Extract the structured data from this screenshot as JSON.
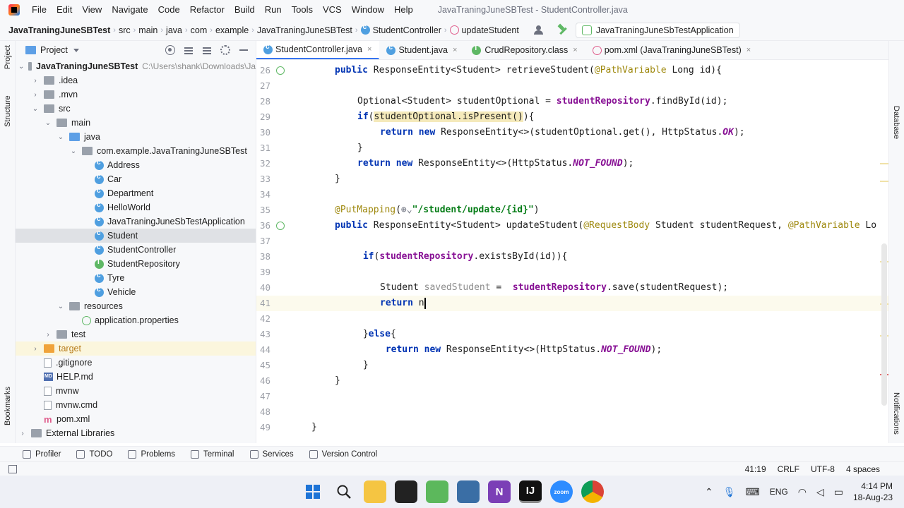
{
  "window": {
    "title": "JavaTraningJuneSBTest - StudentController.java",
    "menu": [
      "File",
      "Edit",
      "View",
      "Navigate",
      "Code",
      "Refactor",
      "Build",
      "Run",
      "Tools",
      "VCS",
      "Window",
      "Help"
    ]
  },
  "breadcrumb": [
    "JavaTraningJuneSBTest",
    "src",
    "main",
    "java",
    "com",
    "example",
    "JavaTraningJuneSBTest",
    "StudentController",
    "updateStudent"
  ],
  "run_config": "JavaTraningJuneSbTestApplication",
  "left_strip": [
    "Project",
    "Structure",
    "Bookmarks"
  ],
  "right_strip": [
    "Database",
    "Notifications"
  ],
  "project_panel": {
    "title": "Project",
    "root_name": "JavaTraningJuneSBTest",
    "root_path": "C:\\Users\\shank\\Downloads\\Ja",
    "items": [
      {
        "label": ".idea",
        "depth": 1,
        "chev": "›",
        "icon": "folder"
      },
      {
        "label": ".mvn",
        "depth": 1,
        "chev": "›",
        "icon": "folder"
      },
      {
        "label": "src",
        "depth": 1,
        "chev": "⌄",
        "icon": "folder"
      },
      {
        "label": "main",
        "depth": 2,
        "chev": "⌄",
        "icon": "folder"
      },
      {
        "label": "java",
        "depth": 3,
        "chev": "⌄",
        "icon": "folder-blue"
      },
      {
        "label": "com.example.JavaTraningJuneSBTest",
        "depth": 4,
        "chev": "⌄",
        "icon": "folder"
      },
      {
        "label": "Address",
        "depth": 5,
        "chev": "",
        "icon": "class"
      },
      {
        "label": "Car",
        "depth": 5,
        "chev": "",
        "icon": "class"
      },
      {
        "label": "Department",
        "depth": 5,
        "chev": "",
        "icon": "class"
      },
      {
        "label": "HelloWorld",
        "depth": 5,
        "chev": "",
        "icon": "class"
      },
      {
        "label": "JavaTraningJuneSbTestApplication",
        "depth": 5,
        "chev": "",
        "icon": "class"
      },
      {
        "label": "Student",
        "depth": 5,
        "chev": "",
        "icon": "class",
        "selected": true
      },
      {
        "label": "StudentController",
        "depth": 5,
        "chev": "",
        "icon": "class"
      },
      {
        "label": "StudentRepository",
        "depth": 5,
        "chev": "",
        "icon": "interface"
      },
      {
        "label": "Tyre",
        "depth": 5,
        "chev": "",
        "icon": "class"
      },
      {
        "label": "Vehicle",
        "depth": 5,
        "chev": "",
        "icon": "class"
      },
      {
        "label": "resources",
        "depth": 3,
        "chev": "⌄",
        "icon": "folder"
      },
      {
        "label": "application.properties",
        "depth": 4,
        "chev": "",
        "icon": "properties"
      },
      {
        "label": "test",
        "depth": 2,
        "chev": "›",
        "icon": "folder"
      },
      {
        "label": "target",
        "depth": 1,
        "chev": "›",
        "icon": "folder-orange",
        "target": true
      },
      {
        "label": ".gitignore",
        "depth": 1,
        "chev": "",
        "icon": "doc"
      },
      {
        "label": "HELP.md",
        "depth": 1,
        "chev": "",
        "icon": "md"
      },
      {
        "label": "mvnw",
        "depth": 1,
        "chev": "",
        "icon": "doc"
      },
      {
        "label": "mvnw.cmd",
        "depth": 1,
        "chev": "",
        "icon": "doc"
      },
      {
        "label": "pom.xml",
        "depth": 1,
        "chev": "",
        "icon": "maven"
      },
      {
        "label": "External Libraries",
        "depth": 0,
        "chev": "›",
        "icon": "lib"
      }
    ]
  },
  "tabs": [
    {
      "label": "StudentController.java",
      "icon": "class",
      "active": true
    },
    {
      "label": "Student.java",
      "icon": "class"
    },
    {
      "label": "CrudRepository.class",
      "icon": "interface"
    },
    {
      "label": "pom.xml (JavaTraningJuneSBTest)",
      "icon": "maven"
    }
  ],
  "code_lines": [
    {
      "n": "26",
      "html": "<span class=\"kw\">public</span> ResponseEntity&lt;Student&gt; retrieveStudent(<span class=\"ann\">@PathVariable</span> Long id){",
      "indent": 0,
      "mark": true
    },
    {
      "n": "27",
      "html": "",
      "indent": 0
    },
    {
      "n": "28",
      "html": "Optional&lt;Student&gt; studentOptional = <span class=\"fld\">studentRepository</span>.findById(id);",
      "indent": 1
    },
    {
      "n": "29",
      "html": "<span class=\"kw\">if</span>(<span class=\"hl2\">studentOptional.isPresent()</span>){",
      "indent": 1
    },
    {
      "n": "30",
      "html": "<span class=\"kw\">return new</span> ResponseEntity&lt;&gt;(studentOptional.get(), HttpStatus.<span class=\"const\">OK</span>);",
      "indent": 2
    },
    {
      "n": "31",
      "html": "}",
      "indent": 1
    },
    {
      "n": "32",
      "html": "<span class=\"kw\">return new</span> ResponseEntity&lt;&gt;(HttpStatus.<span class=\"const\">NOT_FOUND</span>);",
      "indent": 1
    },
    {
      "n": "33",
      "html": "}",
      "indent": 0
    },
    {
      "n": "34",
      "html": "",
      "indent": 0
    },
    {
      "n": "35",
      "html": "<span class=\"ann\">@PutMapping</span>(<span style=\"color:#6c707e\">⊕⌄</span><span class=\"str\">\"/student/update/{id}\"</span>)",
      "indent": 0
    },
    {
      "n": "36",
      "html": "<span class=\"kw\">public</span> ResponseEntity&lt;Student&gt; updateStudent(<span class=\"ann\">@RequestBody</span> Student studentRequest, <span class=\"ann\">@PathVariable</span> Lo",
      "indent": 0,
      "mark": true
    },
    {
      "n": "37",
      "html": "",
      "indent": 0
    },
    {
      "n": "38",
      "html": " <span class=\"kw\">if</span>(<span class=\"fld\">studentRepository</span>.existsById(id)){",
      "indent": 1
    },
    {
      "n": "39",
      "html": "",
      "indent": 0
    },
    {
      "n": "40",
      "html": "Student <span class=\"unused\">savedStudent</span> =  <span class=\"fld\">studentRepository</span>.save(studentRequest);",
      "indent": 2
    },
    {
      "n": "41",
      "html": "<span class=\"kw\">return</span> n<span class=\"caret\"></span>",
      "indent": 2,
      "current": true
    },
    {
      "n": "42",
      "html": "",
      "indent": 0
    },
    {
      "n": "43",
      "html": " }<span class=\"kw\">else</span>{",
      "indent": 1
    },
    {
      "n": "44",
      "html": " <span class=\"kw\">return new</span> ResponseEntity&lt;&gt;(HttpStatus.<span class=\"const\">NOT_FOUND</span>);",
      "indent": 2
    },
    {
      "n": "45",
      "html": " }",
      "indent": 1
    },
    {
      "n": "46",
      "html": "}",
      "indent": 0
    },
    {
      "n": "47",
      "html": "",
      "indent": 0
    },
    {
      "n": "48",
      "html": "",
      "indent": 0
    },
    {
      "n": "49",
      "html": "}",
      "indent": -1
    }
  ],
  "bottom_tools": [
    "Profiler",
    "TODO",
    "Problems",
    "Terminal",
    "Services",
    "Version Control"
  ],
  "status": {
    "position": "41:19",
    "line_sep": "CRLF",
    "encoding": "UTF-8",
    "indent": "4 spaces"
  },
  "taskbar": {
    "apps": [
      "windows",
      "search",
      "explorer",
      "terminal",
      "editor",
      "vscode",
      "onenote",
      "intellij",
      "zoom",
      "chrome"
    ],
    "lang": "ENG",
    "time": "4:14 PM",
    "date": "18-Aug-23"
  }
}
